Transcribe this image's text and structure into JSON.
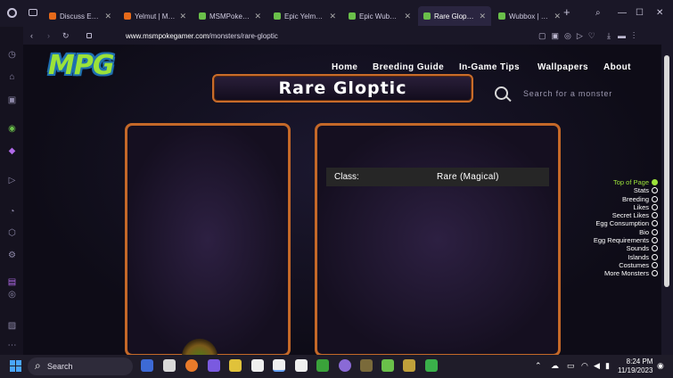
{
  "tabs": [
    {
      "title": "Discuss Everything",
      "fav": "#e66a1a"
    },
    {
      "title": "Yelmut | My Singi",
      "fav": "#e66a1a"
    },
    {
      "title": "MSMPokeGamer",
      "fav": "#6ac04a"
    },
    {
      "title": "Epic Yelmut | MSM",
      "fav": "#6ac04a"
    },
    {
      "title": "Epic Wubbox | MS",
      "fav": "#6ac04a"
    },
    {
      "title": "Rare Gloptic | MSM",
      "fav": "#6ac04a",
      "active": true
    },
    {
      "title": "Wubbox | MSMPo",
      "fav": "#6ac04a"
    }
  ],
  "url": {
    "host": "www.msmpokegamer.com",
    "path": "/monsters/rare-gloptic"
  },
  "site": {
    "logo": "MPG",
    "nav": [
      "Home",
      "Breeding Guide",
      "In-Game Tips",
      "Wallpapers",
      "About"
    ],
    "page_title": "Rare Gloptic",
    "search_placeholder": "Search for a monster"
  },
  "info": {
    "class_label": "Class:",
    "class_value": "Rare (Magical)"
  },
  "toc": [
    "Top of Page",
    "Stats",
    "Breeding",
    "Likes",
    "Secret Likes",
    "Egg Consumption",
    "Bio",
    "Egg Requirements",
    "Sounds",
    "Islands",
    "Costumes",
    "More Monsters"
  ],
  "taskbar": {
    "search_label": "Search",
    "time": "8:24 PM",
    "date": "11/19/2023"
  },
  "colors": {
    "accent_green": "#9be23a",
    "panel_border": "#c46828",
    "logo_outline": "#1f6fb0"
  }
}
